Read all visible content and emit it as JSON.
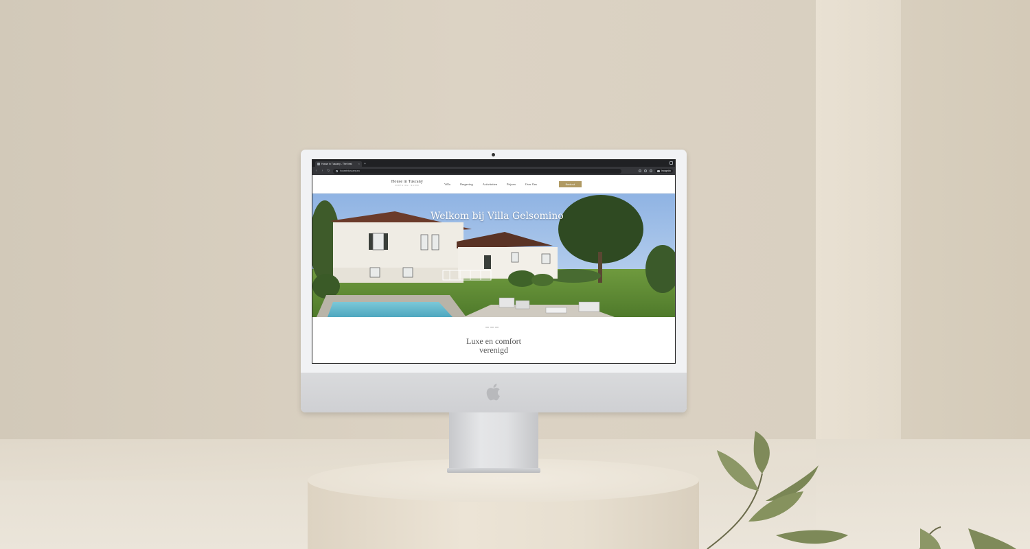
{
  "browser": {
    "tab_title": "House in Tuscany - The best",
    "tab_close": "×",
    "new_tab": "+",
    "url": "houseintuscany.eu",
    "incognito_label": "Incognito",
    "back": "‹",
    "forward": "›",
    "reload": "↻"
  },
  "site": {
    "logo_main": "House in Tuscany",
    "logo_sub": "FORTE DEI MARMI",
    "nav": [
      "Villa",
      "Omgeving",
      "Activiteiten",
      "Prijzen",
      "Over Ons"
    ],
    "cta_label": "Boek nu!",
    "hero_title": "Welkom bij Villa Gelsomino",
    "section_title_line1": "Luxe en comfort",
    "section_title_line2": "verenigd"
  },
  "colors": {
    "accent": "#b09a63",
    "chrome_dark": "#202124",
    "wall": "#d8cfc0"
  },
  "icons": [
    "apple-logo-icon",
    "lock-icon",
    "search-icon",
    "star-icon",
    "incognito-icon"
  ]
}
